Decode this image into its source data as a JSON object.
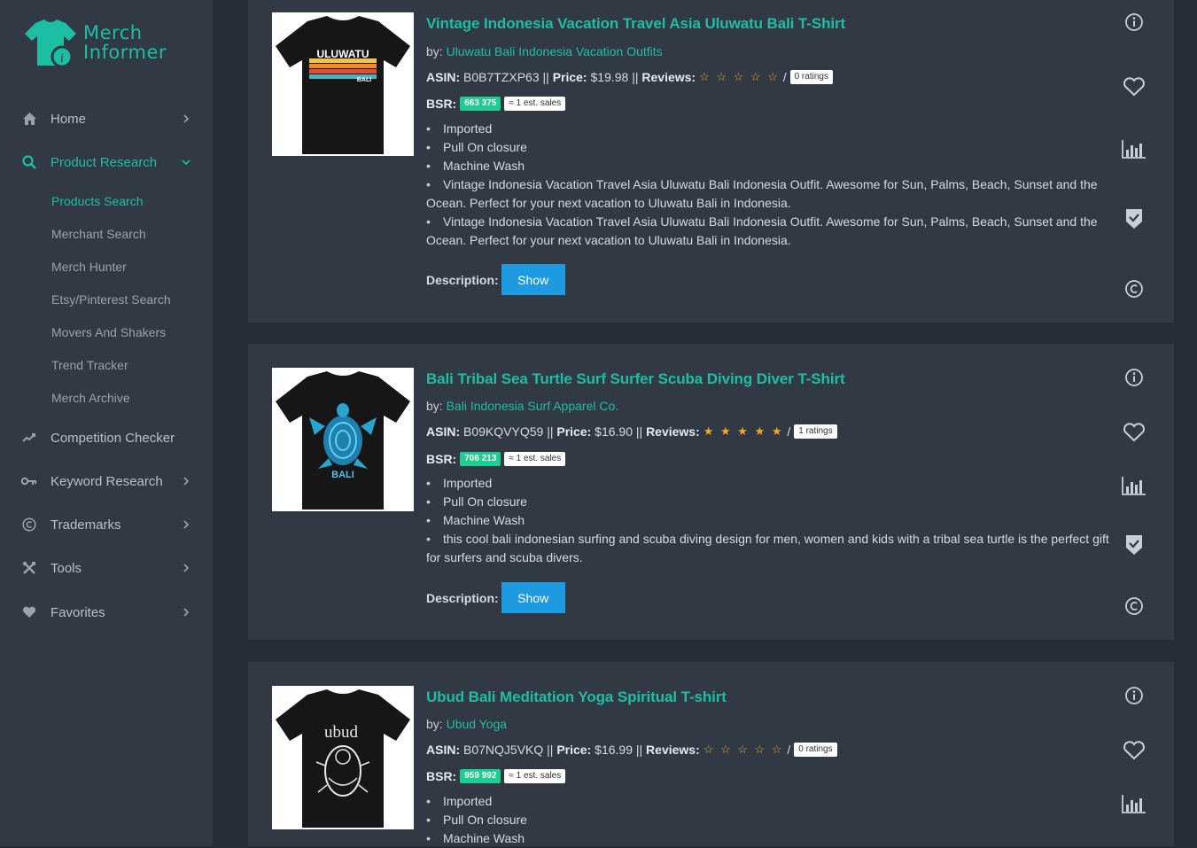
{
  "brand": {
    "line1": "Merch",
    "line2": "Informer",
    "accent": "#1ebea5"
  },
  "sidebar": {
    "items": [
      {
        "label": "Home",
        "icon": "home-icon"
      },
      {
        "label": "Product Research",
        "icon": "search-icon"
      },
      {
        "label": "Competition Checker",
        "icon": "trend-icon"
      },
      {
        "label": "Keyword Research",
        "icon": "key-icon"
      },
      {
        "label": "Trademarks",
        "icon": "copyright-icon"
      },
      {
        "label": "Tools",
        "icon": "tools-icon"
      },
      {
        "label": "Favorites",
        "icon": "heart-icon"
      }
    ],
    "subitems": [
      "Products Search",
      "Merchant Search",
      "Merch Hunter",
      "Etsy/Pinterest Search",
      "Movers And Shakers",
      "Trend Tracker",
      "Merch Archive"
    ]
  },
  "labels": {
    "by": "by:",
    "asin": "ASIN:",
    "price": "Price:",
    "reviews": "Reviews:",
    "bsr": "BSR:",
    "description": "Description:",
    "show": "Show",
    "sep": "||",
    "slash": "/"
  },
  "products": [
    {
      "title": "Vintage Indonesia Vacation Travel Asia Uluwatu Bali T-Shirt",
      "brand": "Uluwatu Bali Indonesia Vacation Outfits",
      "asin": "B0B7TZXP63",
      "price": "$19.98",
      "ratings": "0 ratings",
      "bsr": "663 375",
      "sales": "≈ 1 est. sales",
      "stars": "☆ ☆ ☆ ☆ ☆",
      "bullets": [
        "Imported",
        "Pull On closure",
        "Machine Wash",
        "Vintage Indonesia Vacation Travel Asia Uluwatu Bali Indonesia Outfit. Awesome for Sun, Palms, Beach, Sunset and the",
        "Ocean. Perfect for your next vacation to Uluwatu Bali in Indonesia.",
        "Vintage Indonesia Vacation Travel Asia Uluwatu Bali Indonesia Outfit. Awesome for Sun, Palms, Beach, Sunset and the",
        "Ocean. Perfect for your next vacation to Uluwatu Bali in Indonesia."
      ],
      "shirt_text_1": "ULUWATU",
      "shirt_text_2": "BALI"
    },
    {
      "title": "Bali Tribal Sea Turtle Surf Surfer Scuba Diving Diver T-Shirt",
      "brand": "Bali Indonesia Surf Apparel Co.",
      "asin": "B09KQVYQ59",
      "price": "$16.90",
      "ratings": "1 ratings",
      "bsr": "706 213",
      "sales": "≈ 1 est. sales",
      "stars": "★ ★ ★ ★ ★",
      "bullets": [
        "Imported",
        "Pull On closure",
        "Machine Wash",
        "this cool bali indonesian surfing and scuba diving design for men, women and kids with a tribal sea turtle is the perfect gift",
        "for surfers and scuba divers."
      ],
      "shirt_text_1": "BALI"
    },
    {
      "title": "Ubud Bali Meditation Yoga Spiritual T-shirt",
      "brand": "Ubud Yoga",
      "asin": "B07NQJ5VKQ",
      "price": "$16.99",
      "ratings": "0 ratings",
      "bsr": "959 992",
      "sales": "≈ 1 est. sales",
      "stars": "☆ ☆ ☆ ☆ ☆",
      "bullets": [
        "Imported",
        "Pull On closure",
        "Machine Wash"
      ],
      "shirt_text_1": "ubud"
    }
  ]
}
